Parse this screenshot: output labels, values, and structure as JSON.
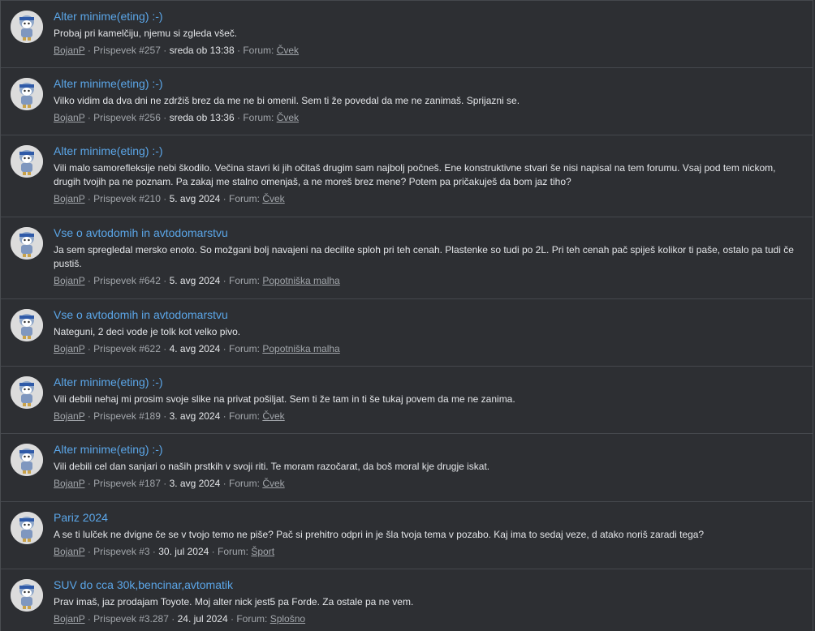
{
  "posts": [
    {
      "title": "Alter minime(eting) :-)",
      "snippet": "Probaj pri kamelčiju, njemu si zgleda všeč.",
      "author": "BojanP",
      "post_no": "Prispevek #257",
      "date": "sreda ob 13:38",
      "forum_label": "Forum:",
      "forum": "Čvek"
    },
    {
      "title": "Alter minime(eting) :-)",
      "snippet": "Vilko vidim da dva dni ne zdržiš brez da me ne bi omenil. Sem ti že povedal da me ne zanimaš. Sprijazni se.",
      "author": "BojanP",
      "post_no": "Prispevek #256",
      "date": "sreda ob 13:36",
      "forum_label": "Forum:",
      "forum": "Čvek"
    },
    {
      "title": "Alter minime(eting) :-)",
      "snippet": "Vili malo samorefleksije nebi škodilo. Večina stavri ki jih očitaš drugim sam najbolj počneš. Ene konstruktivne stvari še nisi napisal na tem forumu. Vsaj pod tem nickom, drugih tvojih pa ne poznam. Pa zakaj me stalno omenjaš, a ne moreš brez mene? Potem pa pričakuješ da bom jaz tiho?",
      "author": "BojanP",
      "post_no": "Prispevek #210",
      "date": "5. avg 2024",
      "forum_label": "Forum:",
      "forum": "Čvek"
    },
    {
      "title": "Vse o avtodomih in avtodomarstvu",
      "snippet": "Ja sem spregledal mersko enoto. So možgani bolj navajeni na decilite sploh pri teh cenah. Plastenke so tudi po 2L. Pri teh cenah pač spiješ kolikor ti paše, ostalo pa tudi če pustiš.",
      "author": "BojanP",
      "post_no": "Prispevek #642",
      "date": "5. avg 2024",
      "forum_label": "Forum:",
      "forum": "Popotniška malha"
    },
    {
      "title": "Vse o avtodomih in avtodomarstvu",
      "snippet": "Nateguni, 2 deci vode je tolk kot velko pivo.",
      "author": "BojanP",
      "post_no": "Prispevek #622",
      "date": "4. avg 2024",
      "forum_label": "Forum:",
      "forum": "Popotniška malha"
    },
    {
      "title": "Alter minime(eting) :-)",
      "snippet": "Vili debili nehaj mi prosim svoje slike na privat pošiljat. Sem ti že tam in ti še tukaj povem da me ne zanima.",
      "author": "BojanP",
      "post_no": "Prispevek #189",
      "date": "3. avg 2024",
      "forum_label": "Forum:",
      "forum": "Čvek"
    },
    {
      "title": "Alter minime(eting) :-)",
      "snippet": "Vili debili cel dan sanjari o naših prstkih v svoji riti. Te moram razočarat, da boš moral kje drugje iskat.",
      "author": "BojanP",
      "post_no": "Prispevek #187",
      "date": "3. avg 2024",
      "forum_label": "Forum:",
      "forum": "Čvek"
    },
    {
      "title": "Pariz 2024",
      "snippet": "A se ti lulček ne dvigne če se v tvojo temo ne piše? Pač si prehitro odpri in je šla tvoja tema v pozabo. Kaj ima to sedaj veze, d atako noriš zaradi tega?",
      "author": "BojanP",
      "post_no": "Prispevek #3",
      "date": "30. jul 2024",
      "forum_label": "Forum:",
      "forum": "Šport"
    },
    {
      "title": "SUV do cca 30k,bencinar,avtomatik",
      "snippet": "Prav imaš, jaz prodajam Toyote. Moj alter nick jest5 pa Forde. Za ostale pa ne vem.",
      "author": "BojanP",
      "post_no": "Prispevek #3.287",
      "date": "24. jul 2024",
      "forum_label": "Forum:",
      "forum": "Splošno"
    }
  ]
}
